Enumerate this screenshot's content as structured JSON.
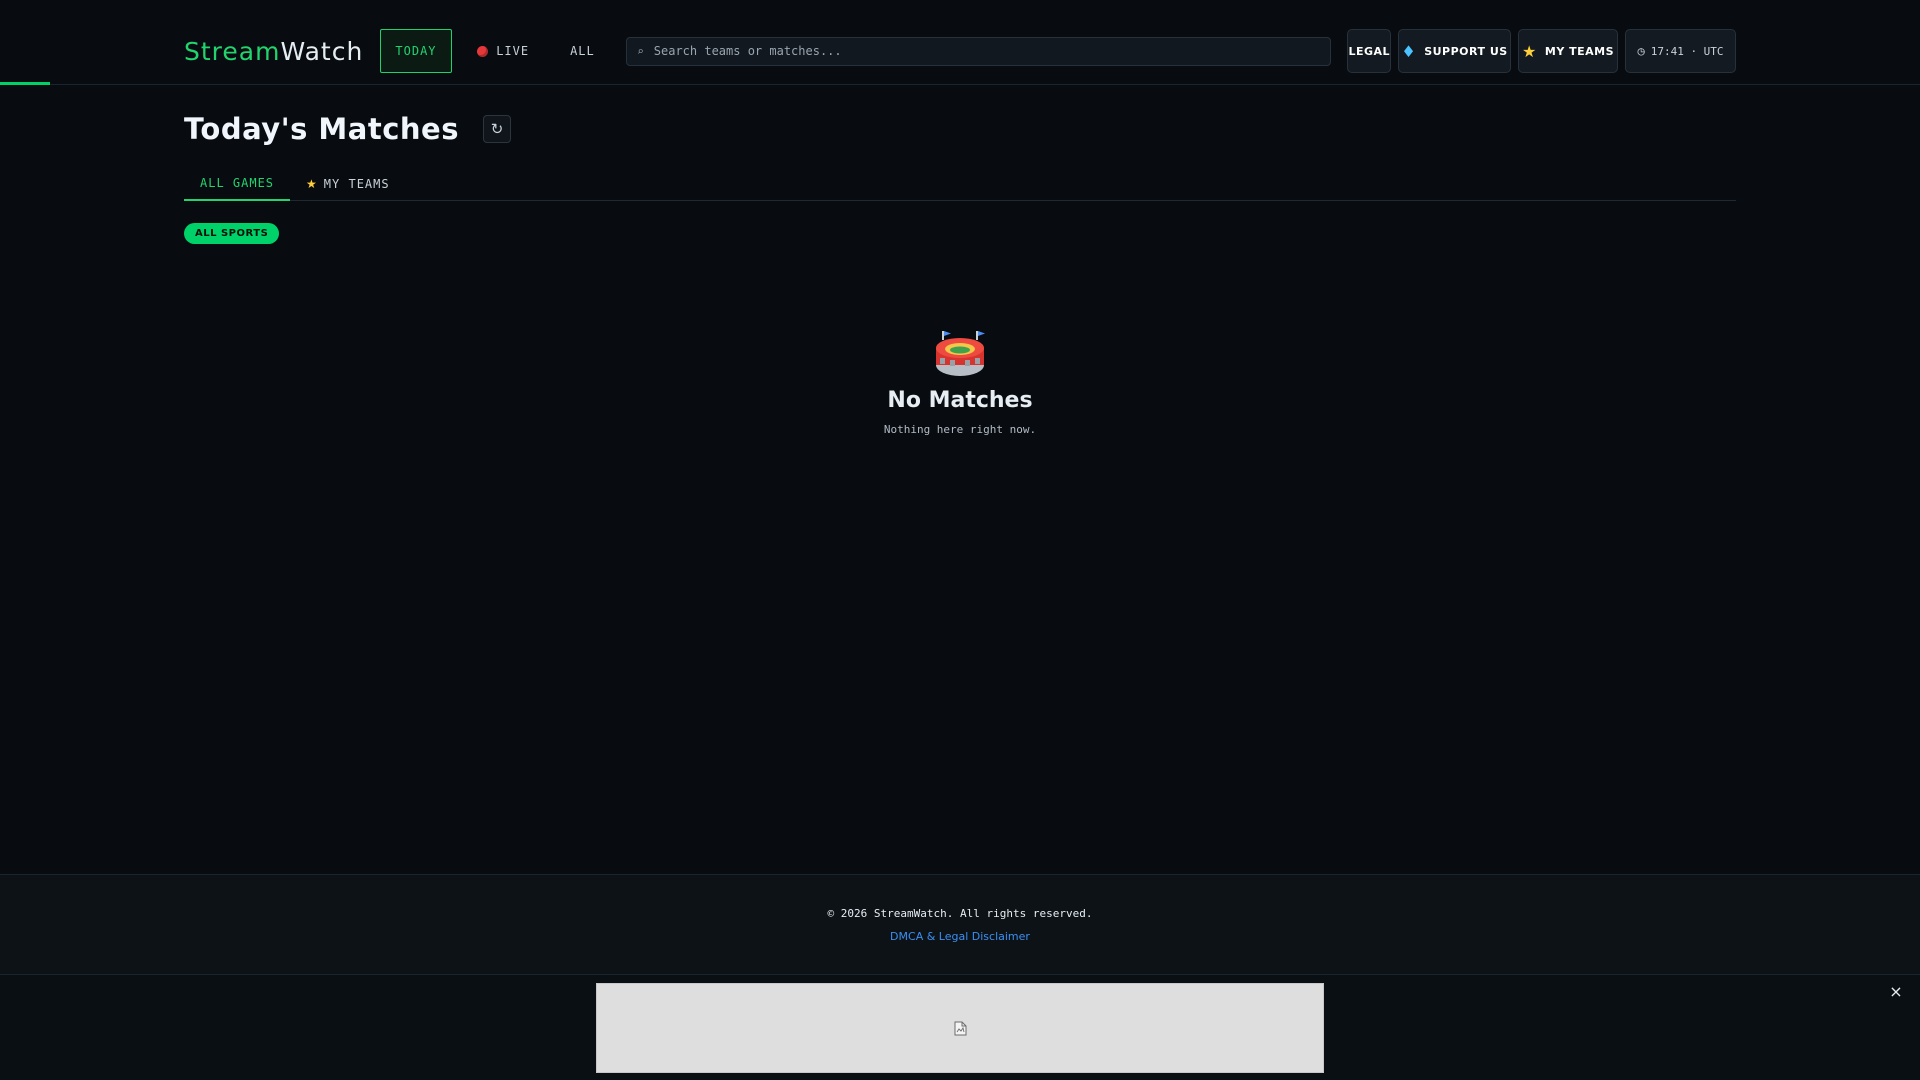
{
  "header": {
    "logo_accent": "Stream",
    "logo_rest": "Watch",
    "nav": {
      "today": "TODAY",
      "live": "LIVE",
      "all": "ALL"
    },
    "search_placeholder": "Search teams or matches...",
    "search_icon": "magnifier-icon",
    "legal_label": "LEGAL",
    "support_label": "SUPPORT US",
    "support_icon": "gem-icon",
    "myteams_label": "MY TEAMS",
    "myteams_icon": "star-icon",
    "clock_icon": "clock-icon",
    "clock_text": "17:41 · UTC"
  },
  "main": {
    "title": "Today's Matches",
    "refresh_symbol": "↻",
    "tabs": [
      {
        "label": "ALL GAMES",
        "active": true
      },
      {
        "label": "MY TEAMS",
        "active": false,
        "icon": "star-icon"
      }
    ],
    "sport_filter": "ALL SPORTS",
    "empty": {
      "icon": "stadium-icon",
      "title": "No Matches",
      "subtitle": "Nothing here right now."
    }
  },
  "footer": {
    "copyright": "© 2026 StreamWatch. All rights reserved.",
    "link": "DMCA & Legal Disclaimer"
  },
  "ad": {
    "close_symbol": "×",
    "image_icon": "broken-image-icon"
  },
  "colors": {
    "accent": "#00d26a",
    "background": "#080c10",
    "live_dot": "#e5383b",
    "link": "#3b8ff3"
  }
}
